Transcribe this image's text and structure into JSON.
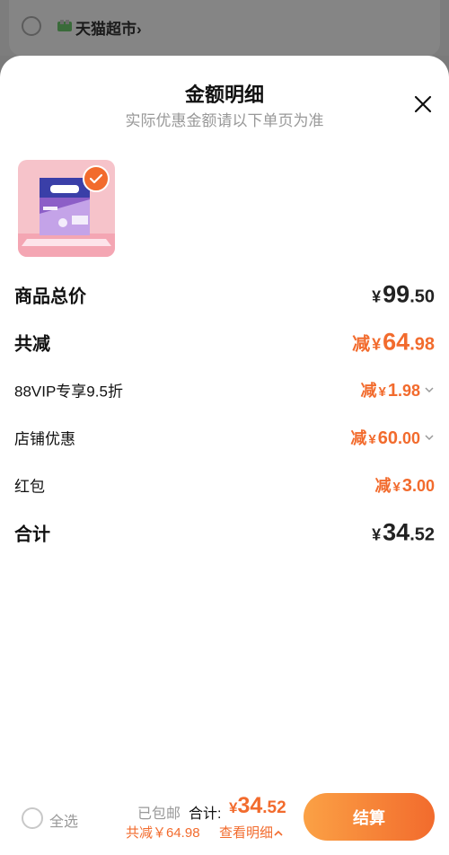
{
  "background": {
    "store_name": "天猫超市",
    "chevron": "›"
  },
  "sheet": {
    "title": "金额明细",
    "subtitle": "实际优惠金额请以下单页为准",
    "close_icon": "close-icon"
  },
  "product": {
    "selected": true,
    "image_icon": "product-image-libresse"
  },
  "rows": {
    "total_price": {
      "label": "商品总价",
      "currency": "¥",
      "int": "99",
      "dec": ".50"
    },
    "discount_total": {
      "label": "共减",
      "prefix": "减",
      "currency": "¥",
      "int": "64",
      "dec": ".98"
    },
    "vip": {
      "label": "88VIP专享9.5折",
      "prefix": "减",
      "currency": "¥",
      "int": "1",
      "dec": ".98"
    },
    "store_coupon": {
      "label": "店铺优惠",
      "prefix": "减",
      "currency": "¥",
      "int": "60",
      "dec": ".00"
    },
    "red_packet": {
      "label": "红包",
      "prefix": "减",
      "currency": "¥",
      "int": "3",
      "dec": ".00"
    },
    "sum": {
      "label": "合计",
      "currency": "¥",
      "int": "34",
      "dec": ".52"
    }
  },
  "footer": {
    "select_all": "全选",
    "shipping": "已包邮",
    "total_label": "合计:",
    "total_currency": "¥",
    "total_int": "34",
    "total_dec": ".52",
    "saved": "共减￥64.98",
    "detail": "查看明细",
    "checkout": "结算"
  },
  "colors": {
    "accent": "#f26b2d",
    "button_start": "#fba145"
  }
}
